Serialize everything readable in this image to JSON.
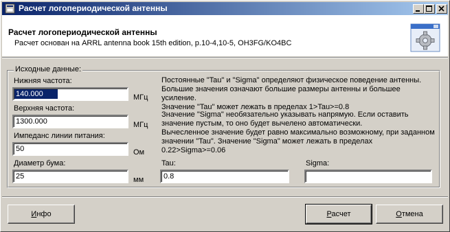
{
  "window": {
    "title": "Расчет логопериодической антенны",
    "controls": {
      "minimize": "minimize",
      "maximize": "maximize",
      "close": "close"
    }
  },
  "header": {
    "title": "Расчет логопериодической антенны",
    "subtitle": "Расчет основан на ARRL antenna book 15th edition, p.10-4,10-5, OH3FG/KO4BC"
  },
  "group": {
    "legend": "Исходные данные:"
  },
  "fields": {
    "low_freq": {
      "label": "Нижняя частота:",
      "value": "140.000",
      "unit": "МГц"
    },
    "high_freq": {
      "label": "Верхняя частота:",
      "value": "1300.000",
      "unit": "МГц"
    },
    "impedance": {
      "label": "Импеданс линии питания:",
      "value": "50",
      "unit": "Ом"
    },
    "boom": {
      "label": "Диаметр бума:",
      "value": "25",
      "unit": "мм"
    },
    "tau": {
      "label": "Tau:",
      "value": "0.8"
    },
    "sigma": {
      "label": "Sigma:",
      "value": ""
    }
  },
  "info": {
    "para1": "Постоянные \"Tau\" и \"Sigma\" определяют физическое поведение антенны.\nБольшие значения означают большие размеры антенны и большее усиление.\nЗначение \"Tau\" может лежать в пределах 1>Tau>=0.8",
    "para2": "Значение \"Sigma\" необязательно указывать напрямую. Если оставить\nзначение пустым, то оно будет вычелено автоматически.\nВычесленное значение будет равно максимально возможному, при заданном\nзначении \"Tau\". Значение \"Sigma\" может лежать в пределах\n0.22>Sigma>=0.06"
  },
  "buttons": {
    "info_prefix": "",
    "info_mnemonic": "И",
    "info_rest": "нфо",
    "calc_prefix": "",
    "calc_mnemonic": "Р",
    "calc_rest": "асчет",
    "cancel_prefix": "",
    "cancel_mnemonic": "О",
    "cancel_rest": "тмена"
  },
  "colors": {
    "titlebar_start": "#0a246a",
    "titlebar_end": "#a6caf0",
    "face": "#d4d0c8"
  }
}
